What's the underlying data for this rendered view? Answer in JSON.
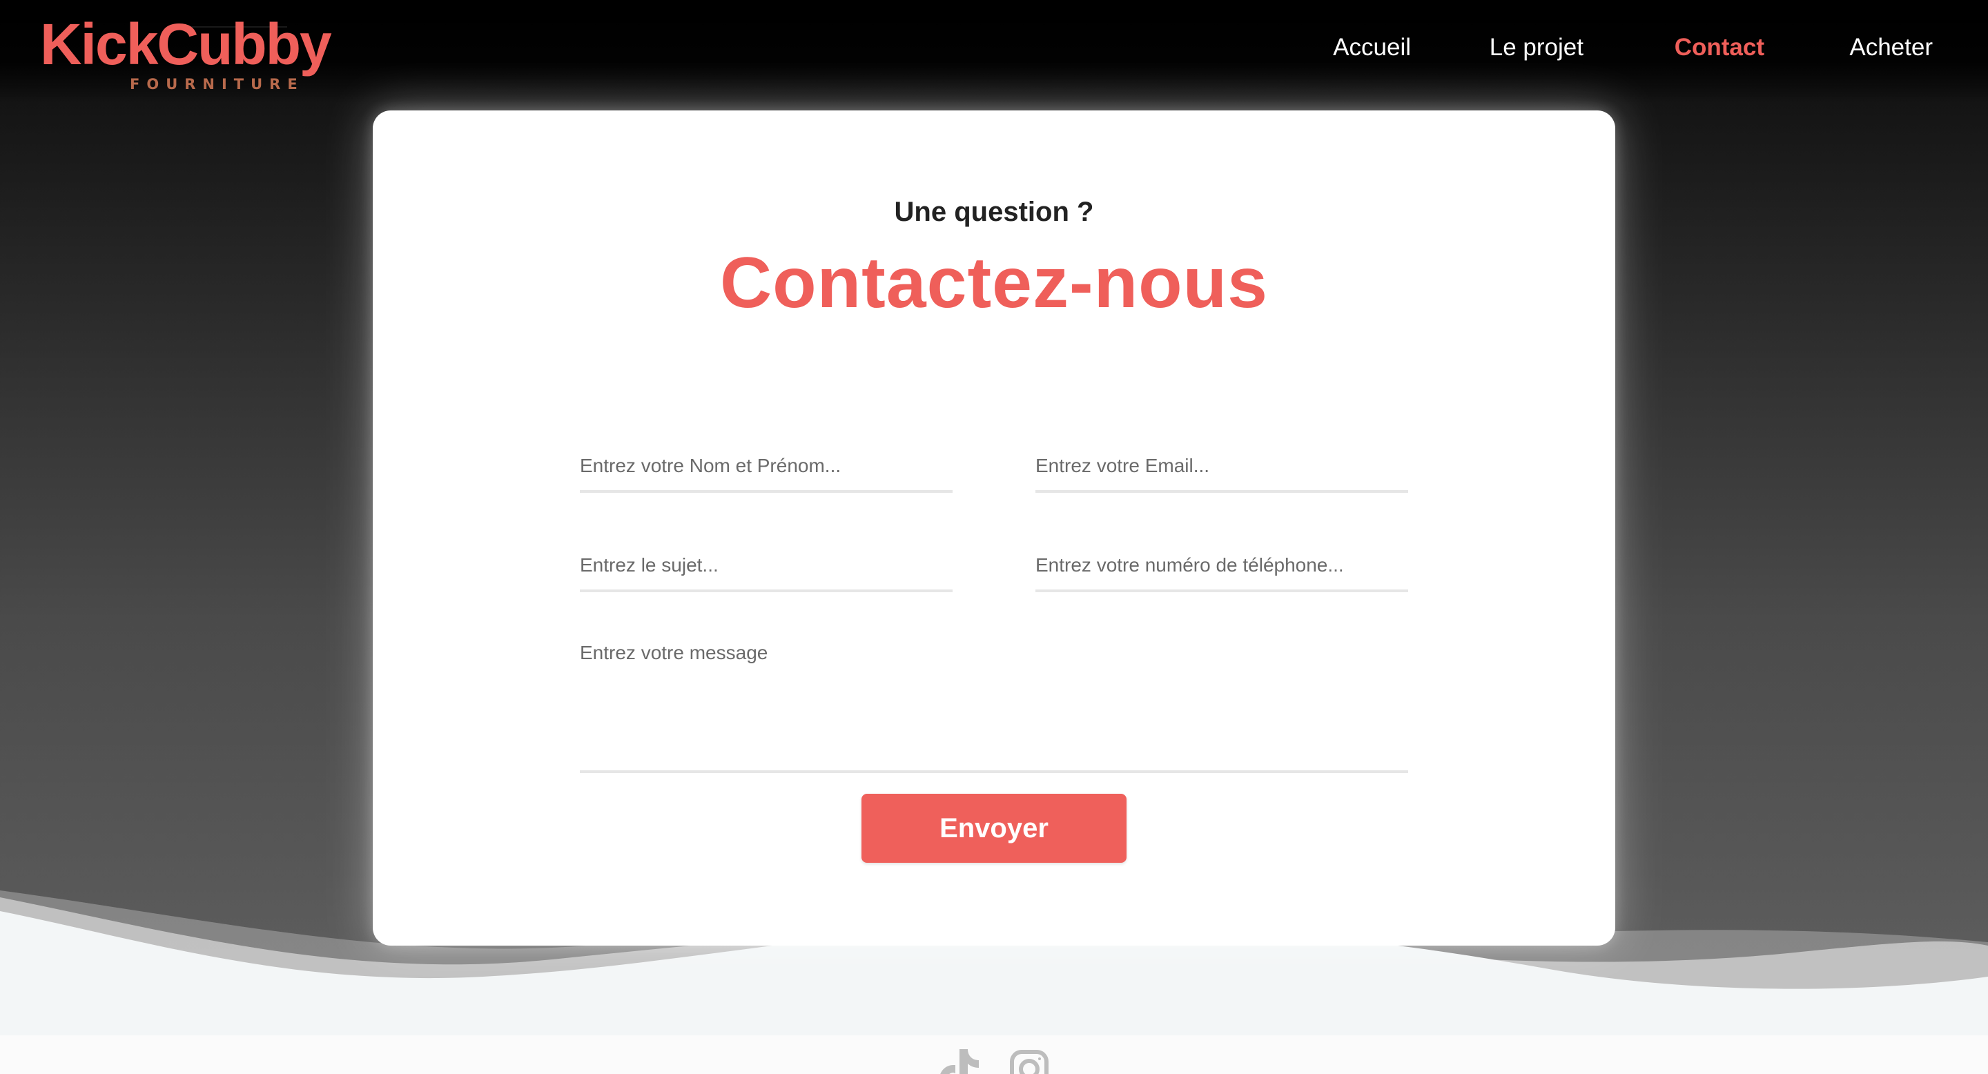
{
  "brand": {
    "name": "KickCubby",
    "tagline": "FOURNITURE",
    "accent_color": "#ef5f5a"
  },
  "nav": {
    "items": [
      {
        "label": "Accueil"
      },
      {
        "label": "Le projet"
      },
      {
        "label": "Contact",
        "active": true
      },
      {
        "label": "Acheter"
      }
    ]
  },
  "contact": {
    "eyebrow": "Une question ?",
    "title": "Contactez-nous",
    "fields": {
      "name_placeholder": "Entrez votre Nom et Prénom...",
      "email_placeholder": "Entrez votre Email...",
      "subject_placeholder": "Entrez le sujet...",
      "phone_placeholder": "Entrez votre numéro de téléphone...",
      "message_placeholder": "Entrez votre message"
    },
    "submit_label": "Envoyer",
    "button_color": "#ef605b"
  },
  "footer": {
    "icons": [
      "tiktok-icon",
      "instagram-icon"
    ]
  }
}
